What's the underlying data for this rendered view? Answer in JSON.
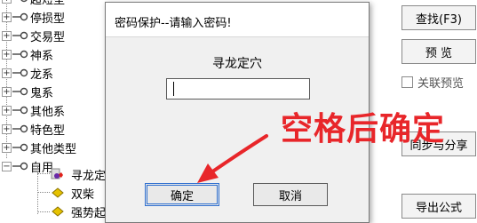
{
  "tree": {
    "nodes": [
      {
        "label": "超短型",
        "expander": "+"
      },
      {
        "label": "停损型",
        "expander": "+"
      },
      {
        "label": "交易型",
        "expander": "+"
      },
      {
        "label": "神系",
        "expander": "+"
      },
      {
        "label": "龙系",
        "expander": "+"
      },
      {
        "label": "鬼系",
        "expander": "+"
      },
      {
        "label": "其他系",
        "expander": "+"
      },
      {
        "label": "特色型",
        "expander": "+"
      },
      {
        "label": "其他类型",
        "expander": "+"
      },
      {
        "label": "自用",
        "expander": "−"
      }
    ],
    "children": [
      {
        "label": "寻龙定"
      },
      {
        "label": "双柴"
      },
      {
        "label": "强势起爆  (用户)"
      }
    ]
  },
  "side_panel": {
    "find_button": "查找(F3)",
    "preview_button": "预 览",
    "linked_preview_label": "关联预览",
    "sync_share_button": "同步与分享",
    "export_button": "导出公式"
  },
  "dialog": {
    "title": "密码保护--请输入密码!",
    "prompt": "寻龙定穴",
    "password_value": "",
    "ok_label": "确定",
    "cancel_label": "取消"
  },
  "annotation": {
    "text": "空格后确定",
    "color": "#e8262a"
  }
}
